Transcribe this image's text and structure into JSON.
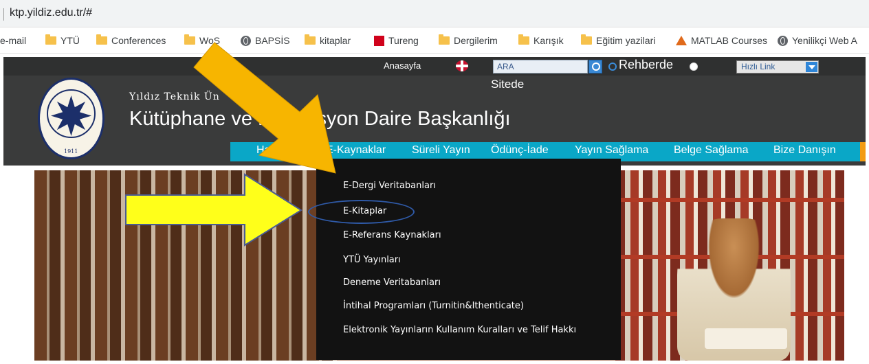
{
  "browser": {
    "url": "ktp.yildiz.edu.tr/#",
    "bookmarks": [
      {
        "label": "e-mail",
        "icon": "none"
      },
      {
        "label": "YTÜ",
        "icon": "folder-icon"
      },
      {
        "label": "Conferences",
        "icon": "folder-icon"
      },
      {
        "label": "WoS",
        "icon": "folder-icon"
      },
      {
        "label": "BAPSİS",
        "icon": "globe-icon"
      },
      {
        "label": "kitaplar",
        "icon": "folder-icon"
      },
      {
        "label": "Tureng",
        "icon": "tureng-icon"
      },
      {
        "label": "Dergilerim",
        "icon": "folder-icon"
      },
      {
        "label": "Karışık",
        "icon": "folder-icon"
      },
      {
        "label": "Eğitim yazilari",
        "icon": "folder-icon"
      },
      {
        "label": "MATLAB Courses",
        "icon": "matlab-icon"
      },
      {
        "label": "Yenilikçi Web A",
        "icon": "globe-icon"
      }
    ]
  },
  "site": {
    "topbar": {
      "home": "Anasayfa",
      "search_placeholder": "ARA",
      "radio_rehber": "Rehberde",
      "radio_sitede": "Sitede",
      "quick_link": "Hızlı Link"
    },
    "university": "Yıldız Teknik Ün",
    "title": "Kütüphane ve D            antasyon Daire Başkanlığı",
    "seal_year": "1911",
    "nav": [
      "Hakkında",
      "E-Kaynaklar",
      "Süreli Yayın",
      "Ödünç-İade",
      "Yayın Sağlama",
      "Belge Sağlama",
      "Bize Danışın"
    ],
    "dropdown": [
      "E-Dergi Veritabanları",
      "E-Kitaplar",
      "E-Referans Kaynakları",
      "YTÜ Yayınları",
      "Deneme Veritabanları",
      "İntihal Programları (Turnitin&Ithenticate)",
      "Elektronik Yayınların Kullanım Kuralları ve Telif Hakkı"
    ]
  },
  "colors": {
    "header_bg": "#3a3b3b",
    "nav_bg": "#0aa7c7",
    "dropdown_bg": "#121212",
    "arrow_orange": "#f7b500",
    "arrow_yellow": "#ffff1a",
    "highlight": "#2f5aa8"
  }
}
